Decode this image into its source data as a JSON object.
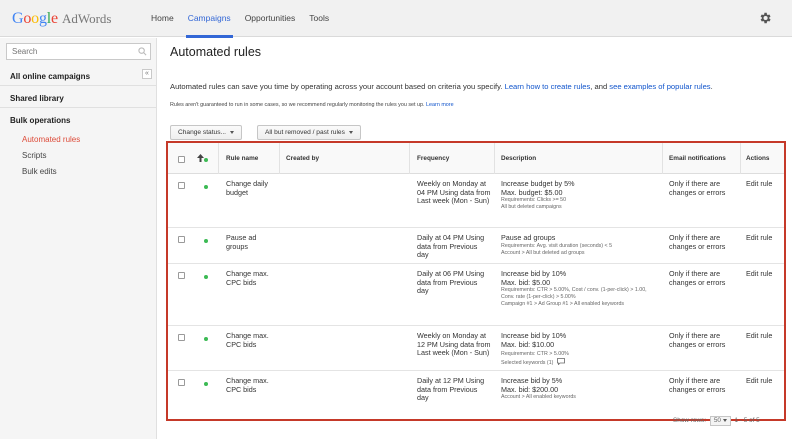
{
  "brand": {
    "product": "AdWords"
  },
  "nav": {
    "items": [
      "Home",
      "Campaigns",
      "Opportunities",
      "Tools"
    ],
    "active": "Campaigns"
  },
  "sidebar": {
    "search_placeholder": "Search",
    "all_campaigns": "All online campaigns",
    "collapse_label": "«",
    "shared_library": "Shared library",
    "bulk_operations": "Bulk operations",
    "links": [
      "Automated rules",
      "Scripts",
      "Bulk edits"
    ]
  },
  "main": {
    "title": "Automated rules",
    "intro_text": "Automated rules can save you time by operating across your account based on criteria you specify. ",
    "intro_link1": "Learn how to create rules",
    "intro_mid": ", and ",
    "intro_link2": "see examples of popular rules",
    "intro_end": ".",
    "disclaimer": "Rules aren't guaranteed to run in some cases, so we recommend regularly monitoring the rules you set up. ",
    "disclaimer_link": "Learn more",
    "change_status_btn": "Change status...",
    "filter_btn": "All but removed / past rules"
  },
  "table": {
    "headers": {
      "rule_name": "Rule name",
      "created_by": "Created by",
      "frequency": "Frequency",
      "description": "Description",
      "email": "Email notifications",
      "actions": "Actions"
    },
    "rows": [
      {
        "name": "Change daily budget",
        "created_by": "",
        "frequency": "Weekly on Monday at 04 PM Using data from Last week (Mon - Sun)",
        "desc_main": "Increase budget by 5%\nMax. budget: $5.00",
        "desc_sub": "Requirements: Clicks >= 50\nAll but deleted campaigns",
        "email": "Only if there are changes or errors",
        "action": "Edit rule"
      },
      {
        "name": "Pause ad groups",
        "created_by": "",
        "frequency": "Daily at 04 PM Using data from Previous day",
        "desc_main": "Pause ad groups",
        "desc_sub": "Requirements: Avg. visit duration (seconds) < 5\nAccount > All but deleted ad groups",
        "email": "Only if there are changes or errors",
        "action": "Edit rule"
      },
      {
        "name": "Change max. CPC bids",
        "created_by": "",
        "frequency": "Daily at 06 PM Using data from Previous day",
        "desc_main": "Increase bid by 10%\nMax. bid: $5.00",
        "desc_sub": "Requirements: CTR > 5.00%, Cost / conv. (1-per-click) > 1.00, Conv. rate (1-per-click) > 5.00%\nCampaign #1 > Ad Group #1 > All enabled keywords",
        "email": "Only if there are changes or errors",
        "action": "Edit rule"
      },
      {
        "name": "Change max. CPC bids",
        "created_by": "",
        "frequency": "Weekly on Monday at 12 PM Using data from Last week (Mon - Sun)",
        "desc_main": "Increase bid by 10%\nMax. bid: $10.00",
        "desc_sub": "Requirements: CTR > 5.00%\nSelected keywords (1)",
        "email": "Only if there are changes or errors",
        "action": "Edit rule"
      },
      {
        "name": "Change max. CPC bids",
        "created_by": "",
        "frequency": "Daily at 12 PM Using data from Previous day",
        "desc_main": "Increase bid by 5%\nMax. bid: $200.00",
        "desc_sub": "Account > All enabled keywords",
        "email": "Only if there are changes or errors",
        "action": "Edit rule"
      }
    ]
  },
  "footer": {
    "show_rows_label": "Show rows:",
    "show_rows_value": "50",
    "range": "1 - 5 of 5"
  },
  "colors": {
    "accent": "#3367d6",
    "active_link": "#dd4b39",
    "highlight_border": "#c53929",
    "status_green": "#3cba54"
  },
  "icons": [
    "search-icon",
    "settings-gear-icon",
    "sort-arrow-icon",
    "status-dot-icon",
    "comment-icon"
  ]
}
